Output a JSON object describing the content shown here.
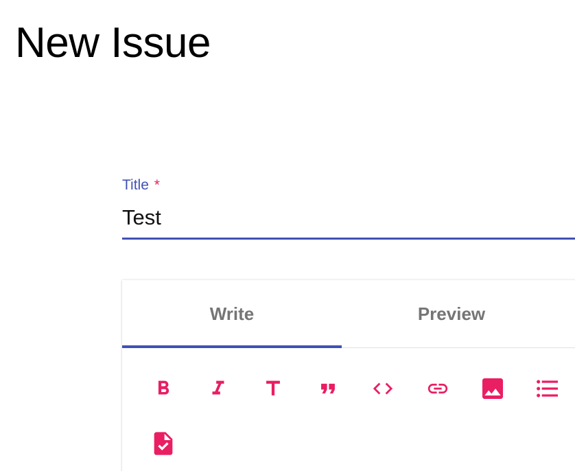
{
  "page": {
    "title": "New Issue"
  },
  "form": {
    "title_field": {
      "label": "Title",
      "required_mark": "*",
      "value": "Test"
    }
  },
  "editor": {
    "tabs": [
      {
        "label": "Write",
        "active": true
      },
      {
        "label": "Preview",
        "active": false
      }
    ],
    "toolbar": [
      "bold-icon",
      "italic-icon",
      "header-icon",
      "quote-icon",
      "code-icon",
      "link-icon",
      "image-icon",
      "unordered-list-icon",
      "checklist-icon"
    ]
  },
  "colors": {
    "primary": "#3f51b5",
    "accent": "#e91e63",
    "tab_text": "#757575"
  }
}
